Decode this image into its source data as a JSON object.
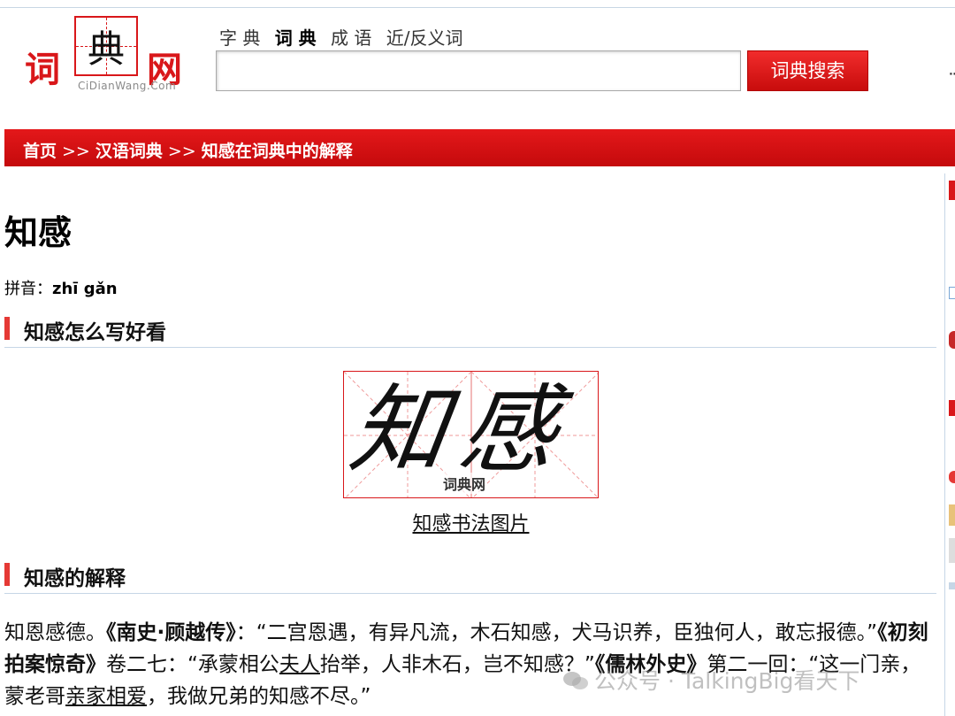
{
  "logo": {
    "left": "词",
    "center": "典",
    "right": "网",
    "domain": "CiDianWang.Com"
  },
  "search": {
    "tabs": [
      {
        "label": "字 典",
        "active": false
      },
      {
        "label": "词 典",
        "active": true
      },
      {
        "label": "成 语",
        "active": false
      },
      {
        "label": "近/反义词",
        "active": false
      }
    ],
    "input_value": "",
    "button_label": "词典搜索"
  },
  "breadcrumb": {
    "items": [
      "首页",
      "汉语词典",
      "知感在词典中的解释"
    ],
    "separator": ">>"
  },
  "entry": {
    "word": "知感",
    "pinyin_label": "拼音：",
    "pinyin": "zhī gǎn",
    "section_writing": "知感怎么写好看",
    "calligraphy_text": "知感",
    "calligraphy_watermark": "词典网",
    "calligraphy_link": "知感书法图片",
    "section_explain": "知感的解释",
    "explanation": {
      "p1": "知恩感德。",
      "s1": "《南史·顾越传》",
      "p2": "：“二宫恩遇，有异凡流，木石知感，犬马识养，臣独何人，敢忘报德。”",
      "s2": "《初刻拍案惊奇》",
      "p3": "卷二七：“承蒙相公",
      "u1": "夫人",
      "p4": "抬举，人非木石，岂不知感？”",
      "s3": "《儒林外史》",
      "p5": "第二一回：“这一门亲，蒙老哥",
      "u2": "亲家相爱",
      "p6": "，我做兄弟的知感不尽。”"
    }
  },
  "watermark": "公众号 · TalkingBig看天下",
  "colors": {
    "brand_red": "#d9171a",
    "bar_red": "#e53935",
    "divider": "#c6d6e6"
  }
}
